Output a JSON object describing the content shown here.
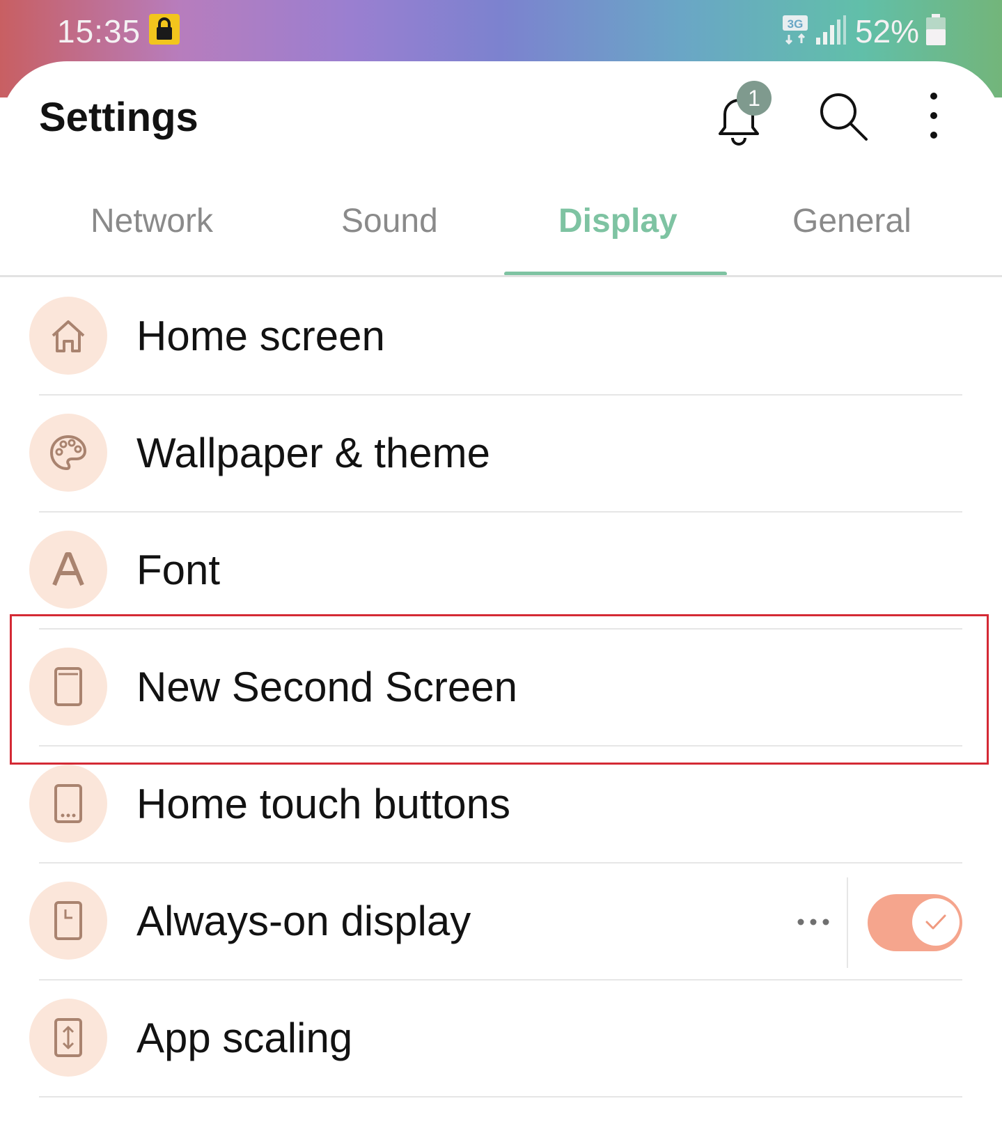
{
  "status_bar": {
    "time": "15:35",
    "network_type": "3G",
    "battery": "52%",
    "icons": [
      "lock-icon",
      "data-transfer-icon",
      "signal-icon",
      "battery-icon"
    ]
  },
  "header": {
    "title": "Settings",
    "notification_count": "1",
    "icons": [
      "bell-icon",
      "search-icon",
      "more-vert-icon"
    ]
  },
  "tabs": [
    {
      "label": "Network",
      "active": false
    },
    {
      "label": "Sound",
      "active": false
    },
    {
      "label": "Display",
      "active": true
    },
    {
      "label": "General",
      "active": false
    }
  ],
  "items": [
    {
      "label": "Home screen",
      "icon": "home-icon"
    },
    {
      "label": "Wallpaper & theme",
      "icon": "palette-icon"
    },
    {
      "label": "Font",
      "icon": "font-icon"
    },
    {
      "label": "New Second Screen",
      "icon": "phone-icon",
      "highlighted": true
    },
    {
      "label": "Home touch buttons",
      "icon": "phone-buttons-icon"
    },
    {
      "label": "Always-on display",
      "icon": "phone-clock-icon",
      "toggle_on": true
    },
    {
      "label": "App scaling",
      "icon": "app-scaling-icon"
    }
  ],
  "colors": {
    "accent": "#7ec3a2",
    "icon_bg": "#fbe6da",
    "icon_stroke": "#a9836f",
    "toggle_on": "#f5a58d",
    "highlight_border": "#d42a35"
  }
}
